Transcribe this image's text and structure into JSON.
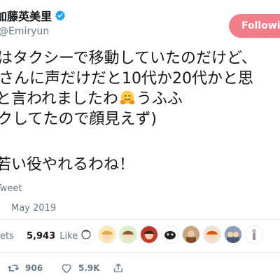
{
  "header": {
    "display_name": "加藤英美里",
    "handle": "Emiryun",
    "follow_label": "Following"
  },
  "tweet": {
    "lines": [
      "はタクシーで移動していたのだけど、",
      "さんに声だけだと10代か20代かと思",
      "と言われましたわ",
      "うふふ",
      "クしてたので顔見えず)",
      "若い役やれるわね！"
    ],
    "emoji": "hugging-face"
  },
  "translate_label": "Tweet",
  "timestamp": "May 2019",
  "stats": {
    "retweets_label": "ets",
    "likes_count": "5,943",
    "likes_label": "Likes"
  },
  "likers_count_shown": 9,
  "actions": {
    "retweet_count": "906",
    "like_count": "5.9K"
  },
  "colors": {
    "follow_button": "#f37c8a",
    "verified_badge": "#1da1f2",
    "secondary_text": "#657786",
    "divider": "#e6ecf0"
  }
}
